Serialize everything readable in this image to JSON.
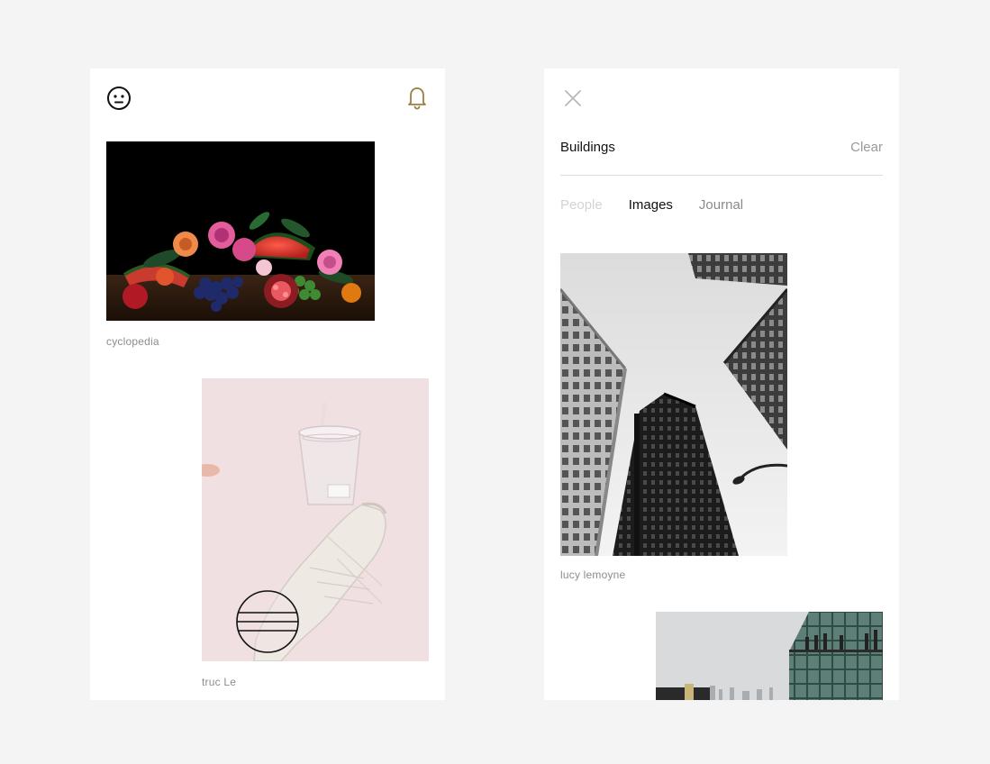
{
  "feed": {
    "profile_icon": "face-icon",
    "notifications_icon": "bell-icon",
    "posts": [
      {
        "author": "cyclopedia",
        "image": "still-life-fruit-flowers-photo"
      },
      {
        "author": "truc Le",
        "image": "sneaker-cup-pink-photo"
      }
    ],
    "overlay_icon": "striped-circle-logo-icon"
  },
  "search": {
    "close_icon": "close-icon",
    "query": "Buildings",
    "clear_label": "Clear",
    "tabs": [
      {
        "label": "People",
        "state": "disabled"
      },
      {
        "label": "Images",
        "state": "active"
      },
      {
        "label": "Journal",
        "state": "inactive"
      }
    ],
    "results": [
      {
        "author": "lucy lemoyne",
        "image": "skyscrapers-looking-up-photo"
      },
      {
        "author": "",
        "image": "glass-building-rooftop-photo"
      }
    ]
  },
  "colors": {
    "background": "#f4f4f4",
    "panel": "#ffffff",
    "bell_accent": "#9a8040",
    "caption": "#8d8d8d",
    "divider": "#dcdcdc"
  }
}
